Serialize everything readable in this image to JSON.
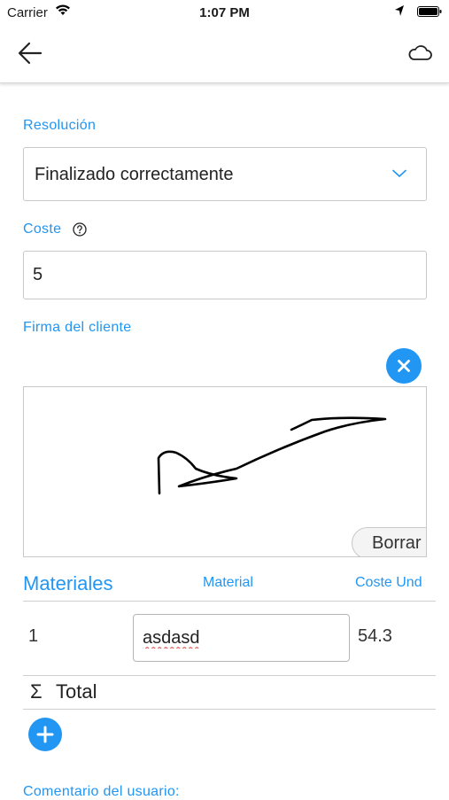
{
  "status_bar": {
    "carrier": "Carrier",
    "time": "1:07 PM"
  },
  "nav": {
    "back_icon": "arrow-left-icon",
    "cloud_icon": "cloud-icon"
  },
  "form": {
    "resolution_label": "Resolución",
    "resolution_value": "Finalizado correctamente",
    "cost_label": "Coste",
    "cost_value": "5",
    "signature_label": "Firma del cliente",
    "clear_signature_label": "Borrar",
    "comment_label": "Comentario del usuario:"
  },
  "materials": {
    "title": "Materiales",
    "col_material": "Material",
    "col_unit_cost": "Coste Und",
    "rows": [
      {
        "index": "1",
        "material": "asdasd",
        "unit_cost": "54.3"
      }
    ],
    "sigma": "Σ",
    "total_label": "Total"
  },
  "colors": {
    "accent": "#2196f3",
    "border": "#c8c8c8",
    "spellcheck": "#e53935"
  }
}
